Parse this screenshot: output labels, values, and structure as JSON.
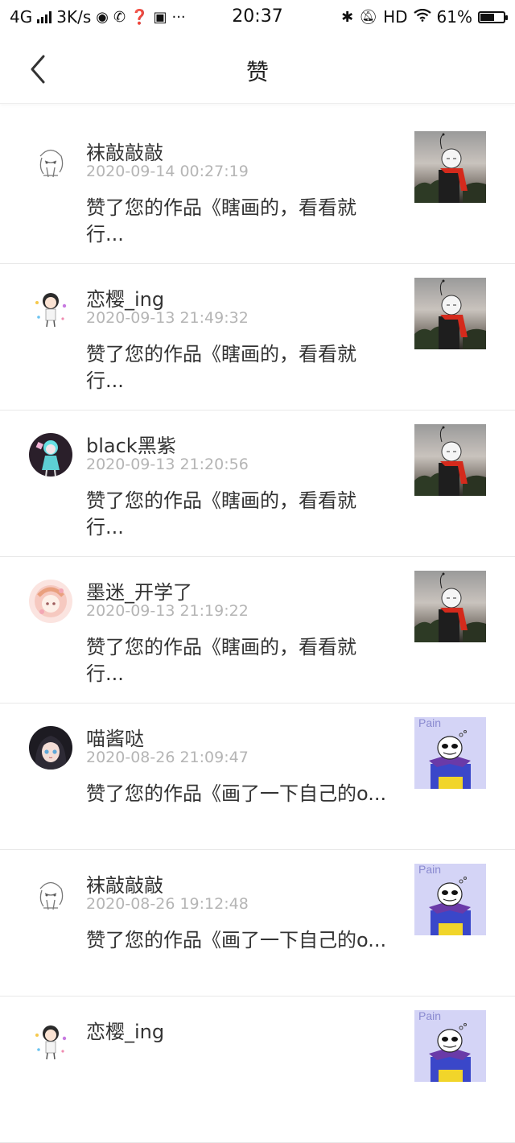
{
  "status_bar": {
    "network": "4G",
    "speed": "3K/s",
    "time": "20:37",
    "hd": "HD",
    "battery": "61%",
    "battery_level": 0.61
  },
  "header": {
    "title": "赞"
  },
  "items": [
    {
      "user": "袜敲敲敲",
      "time": "2020-09-14 00:27:19",
      "message": "赞了您的作品《瞎画的，看看就行...",
      "avatar": "sketch-avatar",
      "thumb": "sky-drawing"
    },
    {
      "user": "恋樱_ing",
      "time": "2020-09-13 21:49:32",
      "message": "赞了您的作品《瞎画的，看看就行...",
      "avatar": "chibi-avatar",
      "thumb": "sky-drawing"
    },
    {
      "user": "black黑紫",
      "time": "2020-09-13 21:20:56",
      "message": "赞了您的作品《瞎画的，看看就行...",
      "avatar": "dark-anime-avatar",
      "thumb": "sky-drawing"
    },
    {
      "user": "墨迷_开学了",
      "time": "2020-09-13 21:19:22",
      "message": "赞了您的作品《瞎画的，看看就行...",
      "avatar": "pink-avatar",
      "thumb": "sky-drawing"
    },
    {
      "user": "喵酱哒",
      "time": "2020-08-26 21:09:47",
      "message": "赞了您的作品《画了一下自己的o...",
      "avatar": "dark-hair-avatar",
      "thumb": "sans-drawing"
    },
    {
      "user": "袜敲敲敲",
      "time": "2020-08-26 19:12:48",
      "message": "赞了您的作品《画了一下自己的o...",
      "avatar": "sketch-avatar",
      "thumb": "sans-drawing"
    },
    {
      "user": "恋樱_ing",
      "time": "",
      "message": "",
      "avatar": "chibi-avatar",
      "thumb": "sans-drawing"
    }
  ],
  "thumb_pain_label": "Pain"
}
